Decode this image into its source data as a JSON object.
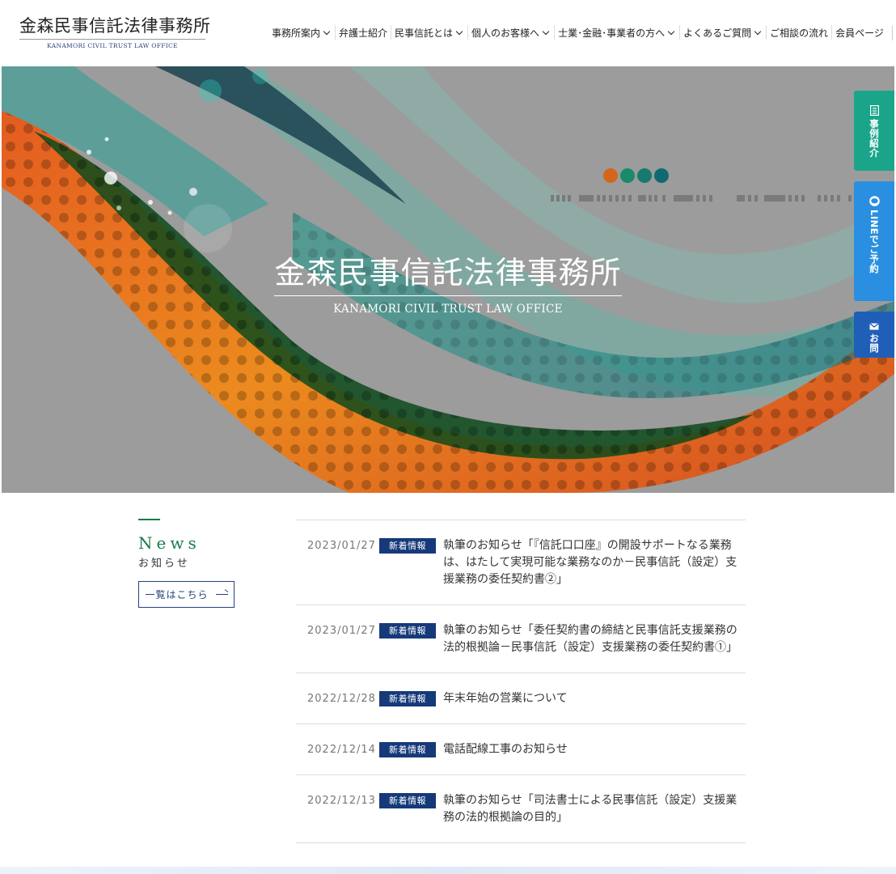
{
  "header": {
    "logo_jp": "金森民事信託法律事務所",
    "logo_en": "KANAMORI CIVIL TRUST LAW OFFICE",
    "nav": [
      {
        "label": "事務所案内",
        "dropdown": true
      },
      {
        "label": "弁護士紹介",
        "dropdown": false
      },
      {
        "label": "民事信託とは",
        "dropdown": true
      },
      {
        "label": "個人のお客様へ",
        "dropdown": true
      },
      {
        "label": "士業･金融･事業者の方へ",
        "dropdown": true
      },
      {
        "label": "よくあるご質問",
        "dropdown": true
      },
      {
        "label": "ご相談の流れ",
        "dropdown": false
      },
      {
        "label": "会員ページ",
        "dropdown": false
      }
    ]
  },
  "hero": {
    "title_jp": "金森民事信託法律事務所",
    "title_en": "KANAMORI CIVIL TRUST LAW OFFICE",
    "dot_colors": [
      "#d3661a",
      "#1a8a6a",
      "#177a6e",
      "#0f6a70"
    ]
  },
  "side_tabs": {
    "cases": {
      "label": "事例紹介",
      "icon": "book-icon",
      "color": "#1aa58a"
    },
    "line": {
      "label": "LINEでご予約",
      "icon": "line-chat-icon",
      "color": "#2a8fe0"
    },
    "mail": {
      "label": "お問",
      "icon": "mail-icon",
      "color": "#1f5fb8"
    }
  },
  "news": {
    "title": "News",
    "subtitle": "お知らせ",
    "more_button": "一覧はこちら",
    "items": [
      {
        "date": "2023/01/27",
        "badge": "新着情報",
        "text": "執筆のお知らせ「『信託口口座』の開設サポートなる業務は、はたして実現可能な業務なのか－民事信託（設定）支援業務の委任契約書②」"
      },
      {
        "date": "2023/01/27",
        "badge": "新着情報",
        "text": "執筆のお知らせ「委任契約書の締結と民事信託支援業務の法的根拠論－民事信託（設定）支援業務の委任契約書①」"
      },
      {
        "date": "2022/12/28",
        "badge": "新着情報",
        "text": "年末年始の営業について"
      },
      {
        "date": "2022/12/14",
        "badge": "新着情報",
        "text": "電話配線工事のお知らせ"
      },
      {
        "date": "2022/12/13",
        "badge": "新着情報",
        "text": "執筆のお知らせ「司法書士による民事信託（設定）支援業務の法的根拠論の目的」"
      }
    ]
  },
  "colors": {
    "accent_green": "#1a7a4a",
    "navy": "#16397a"
  }
}
